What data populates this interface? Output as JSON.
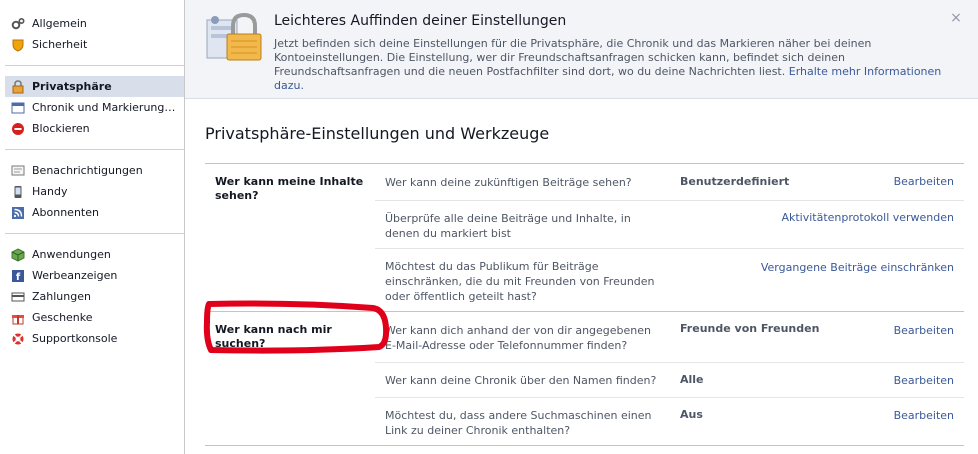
{
  "sidebar": {
    "groups": [
      [
        {
          "label": "Allgemein",
          "icon": "gears-icon"
        },
        {
          "label": "Sicherheit",
          "icon": "shield-icon"
        }
      ],
      [
        {
          "label": "Privatsphäre",
          "icon": "lock-icon",
          "active": true
        },
        {
          "label": "Chronik und Markierung…",
          "icon": "timeline-icon"
        },
        {
          "label": "Blockieren",
          "icon": "block-icon"
        }
      ],
      [
        {
          "label": "Benachrichtigungen",
          "icon": "notifications-icon"
        },
        {
          "label": "Handy",
          "icon": "phone-icon"
        },
        {
          "label": "Abonnenten",
          "icon": "rss-icon"
        }
      ],
      [
        {
          "label": "Anwendungen",
          "icon": "apps-icon"
        },
        {
          "label": "Werbeanzeigen",
          "icon": "ads-icon"
        },
        {
          "label": "Zahlungen",
          "icon": "credit-card-icon"
        },
        {
          "label": "Geschenke",
          "icon": "gift-icon"
        },
        {
          "label": "Supportkonsole",
          "icon": "lifebuoy-icon"
        }
      ]
    ]
  },
  "notice": {
    "title": "Leichteres Auffinden deiner Einstellungen",
    "body": "Jetzt befinden sich deine Einstellungen für die Privatsphäre, die Chronik und das Markieren näher bei deinen Kontoeinstellungen. Die Einstellung, wer dir Freundschaftsanfragen schicken kann, befindet sich deinen Freundschaftsanfragen und die neuen Postfachfilter sind dort, wo du deine Nachrichten liest.",
    "link": "Erhalte mehr Informationen dazu.",
    "close": "×"
  },
  "page_title": "Privatsphäre-Einstellungen und Werkzeuge",
  "sections": [
    {
      "label": "Wer kann meine Inhalte sehen?",
      "rows": [
        {
          "question": "Wer kann deine zukünftigen Beiträge sehen?",
          "value": "Benutzerdefiniert",
          "action": "Bearbeiten"
        },
        {
          "question": "Überprüfe alle deine Beiträge und Inhalte, in denen du markiert bist",
          "value": "",
          "action": "Aktivitätenprotokoll verwenden"
        },
        {
          "question": "Möchtest du das Publikum für Beiträge einschränken, die du mit Freunden von Freunden oder öffentlich geteilt hast?",
          "value": "",
          "action": "Vergangene Beiträge einschränken"
        }
      ]
    },
    {
      "label": "Wer kann nach mir suchen?",
      "rows": [
        {
          "question": "Wer kann dich anhand der von dir angegebenen E-Mail-Adresse oder Telefonnummer finden?",
          "value": "Freunde von Freunden",
          "action": "Bearbeiten"
        },
        {
          "question": "Wer kann deine Chronik über den Namen finden?",
          "value": "Alle",
          "action": "Bearbeiten"
        },
        {
          "question": "Möchtest du, dass andere Suchmaschinen einen Link zu deiner Chronik enthalten?",
          "value": "Aus",
          "action": "Bearbeiten"
        }
      ]
    }
  ],
  "colors": {
    "link": "#3b5998",
    "annotation": "#e0001b",
    "active_bg": "#d8dfea"
  }
}
